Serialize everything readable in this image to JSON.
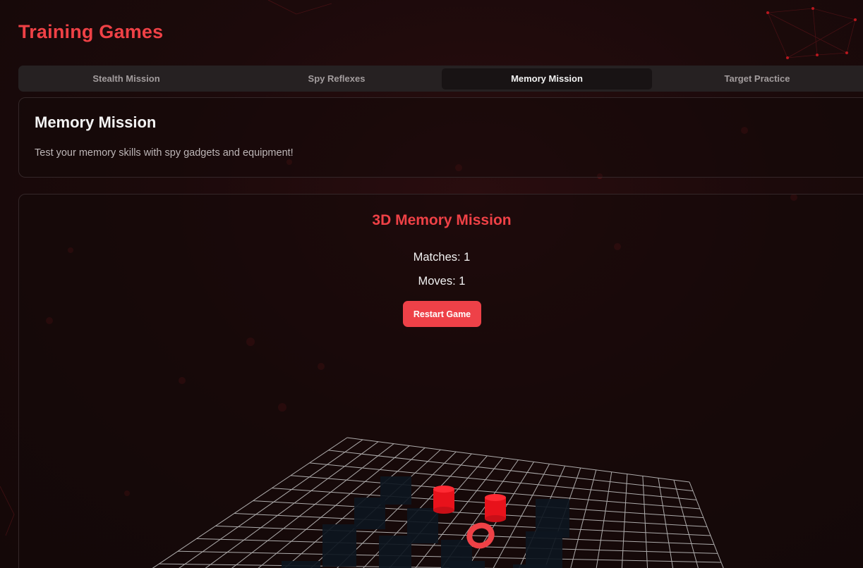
{
  "page": {
    "title": "Training Games"
  },
  "tabs": [
    {
      "label": "Stealth Mission",
      "active": false
    },
    {
      "label": "Spy Reflexes",
      "active": false
    },
    {
      "label": "Memory Mission",
      "active": true
    },
    {
      "label": "Target Practice",
      "active": false
    }
  ],
  "info": {
    "title": "Memory Mission",
    "description": "Test your memory skills with spy gadgets and equipment!"
  },
  "game": {
    "title": "3D Memory Mission",
    "matches": "Matches: 1",
    "moves": "Moves: 1",
    "restart_label": "Restart Game"
  },
  "colors": {
    "accent": "#ef4146",
    "button": "#ee4148",
    "card_dark": "#0d1620",
    "grid": "#c8c8c8"
  }
}
